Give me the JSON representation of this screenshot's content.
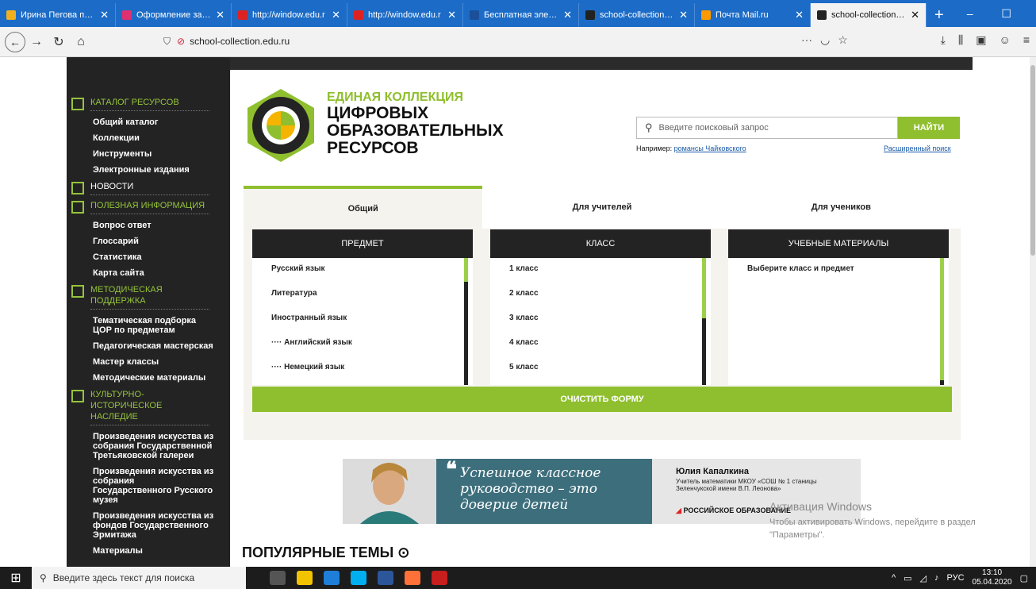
{
  "browser": {
    "tabs": [
      {
        "label": "Ирина Пегова похва",
        "color": "#f0b020"
      },
      {
        "label": "Оформление заказа",
        "color": "#e03070"
      },
      {
        "label": "http://window.edu.r",
        "color": "#d22"
      },
      {
        "label": "http://window.edu.r",
        "color": "#d22"
      },
      {
        "label": "Бесплатная электро",
        "color": "#1b4f9a"
      },
      {
        "label": "school-collection.edu",
        "color": "#222"
      },
      {
        "label": "Почта Mail.ru",
        "color": "#ff9900"
      },
      {
        "label": "school-collection.edu",
        "color": "#222"
      }
    ],
    "active_tab": 7,
    "new_tab": "+",
    "url": "school-collection.edu.ru",
    "url_menu": "···",
    "controls": {
      "minimize": "–",
      "maximize": "☐",
      "close": "✕"
    }
  },
  "sidebar": {
    "sections": [
      {
        "title": "КАТАЛОГ РЕСУРСОВ",
        "items": [
          "Общий каталог",
          "Коллекции",
          "Инструменты",
          "Электронные издания"
        ]
      },
      {
        "title": "НОВОСТИ",
        "items": []
      },
      {
        "title": "ПОЛЕЗНАЯ ИНФОРМАЦИЯ",
        "items": [
          "Вопрос ответ",
          "Глоссарий",
          "Статистика",
          "Карта сайта"
        ]
      },
      {
        "title": "МЕТОДИЧЕСКАЯ ПОДДЕРЖКА",
        "items": [
          "Тематическая подборка ЦОР по предметам",
          "Педагогическая мастерская",
          "Мастер классы",
          "Методические материалы"
        ]
      },
      {
        "title": "КУЛЬТУРНО-ИСТОРИЧЕСКОЕ НАСЛЕДИЕ",
        "items": [
          "Произведения искусства из собрания Государственной Третьяковской галереи",
          "Произведения искусства из собрания Государственного Русского музея",
          "Произведения искусства из фондов Государственного Эрмитажа",
          "Материалы"
        ]
      }
    ]
  },
  "header": {
    "logo_line1": "ЕДИНАЯ КОЛЛЕКЦИЯ",
    "logo_line2": "ЦИФРОВЫХ",
    "logo_line3": "ОБРАЗОВАТЕЛЬНЫХ",
    "logo_line4": "РЕСУРСОВ",
    "search_placeholder": "Введите поисковый запрос",
    "search_button": "НАЙТИ",
    "example_prefix": "Например:",
    "example_link": "романсы Чайковского",
    "advanced_search": "Расширенный поиск"
  },
  "catalog": {
    "tabs": [
      "Общий",
      "Для учителей",
      "Для учеников"
    ],
    "active_tab": 0,
    "columns": [
      {
        "title": "ПРЕДМЕТ",
        "items": [
          "Русский язык",
          "Литература",
          "Иностранный язык",
          "···· Английский язык",
          "···· Немецкий язык"
        ]
      },
      {
        "title": "КЛАСС",
        "items": [
          "1 класс",
          "2 класс",
          "3 класс",
          "4 класс",
          "5 класс"
        ]
      },
      {
        "title": "УЧЕБНЫЕ МАТЕРИАЛЫ",
        "items": [
          "Выберите класс и предмет"
        ]
      }
    ],
    "clear_button": "ОЧИСТИТЬ ФОРМУ"
  },
  "banner": {
    "quote_mark": "❝",
    "quote": "Успешное классное руководство – это доверие детей",
    "author": "Юлия Капалкина",
    "role": "Учитель математики МКОУ «СОШ № 1 станицы Зеленчукской имени В.П. Леонова»",
    "org": "РОССИЙСКОЕ ОБРАЗОВАНИЕ"
  },
  "watermark": {
    "line1": "Активация Windows",
    "line2": "Чтобы активировать Windows, перейдите в раздел \"Параметры\"."
  },
  "popular_title": "ПОПУЛЯРНЫЕ ТЕМЫ ⊙",
  "taskbar": {
    "search_placeholder": "Введите здесь текст для поиска",
    "lang": "РУС",
    "time": "13:10",
    "date": "05.04.2020"
  }
}
